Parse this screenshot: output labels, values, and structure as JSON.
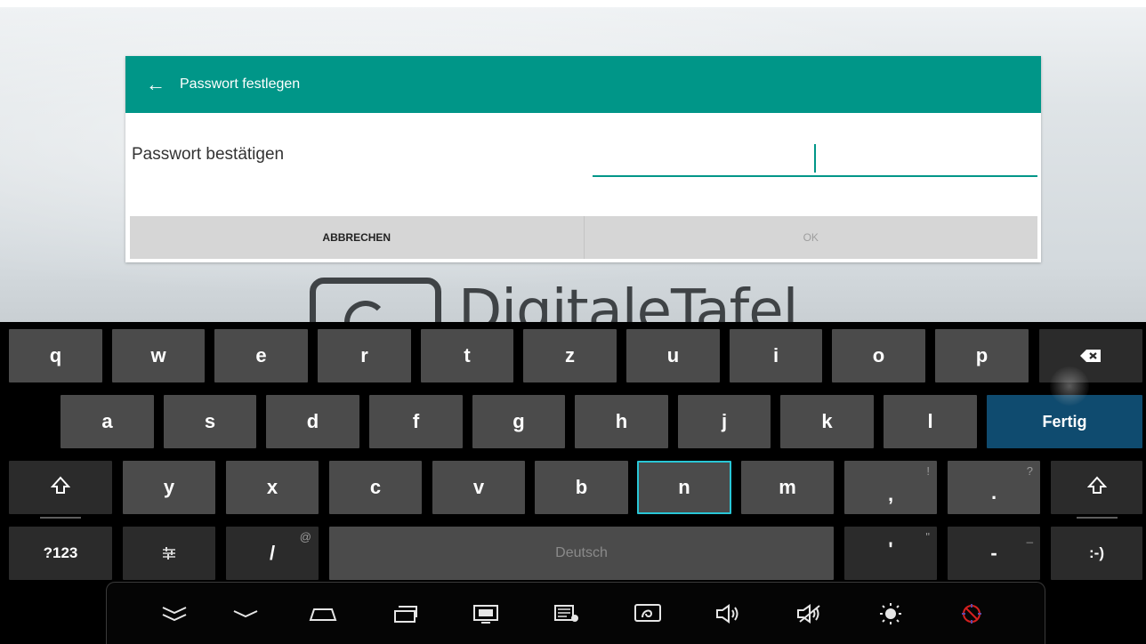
{
  "dialog": {
    "title": "Passwort festlegen",
    "field_label": "Passwort bestätigen",
    "password_value": "",
    "cancel_label": "ABBRECHEN",
    "ok_label": "OK",
    "accent_color": "#009688"
  },
  "background": {
    "logo_text": "DigitaleTafel"
  },
  "keyboard": {
    "row1": [
      "q",
      "w",
      "e",
      "r",
      "t",
      "z",
      "u",
      "i",
      "o",
      "p"
    ],
    "row2": [
      "a",
      "s",
      "d",
      "f",
      "g",
      "h",
      "j",
      "k",
      "l"
    ],
    "row3": [
      "y",
      "x",
      "c",
      "v",
      "b",
      "n",
      "m",
      ",",
      "."
    ],
    "row3_hints": {
      "comma": "!",
      "period": "?"
    },
    "done_label": "Fertig",
    "symbols_label": "?123",
    "slash_label": "/",
    "slash_hint": "@",
    "space_label": "Deutsch",
    "quote_label": "'",
    "quote_hint": "\"",
    "dash_label": "-",
    "dash_hint": "_",
    "smiley_label": ":-)",
    "selected_key": "n",
    "done_color": "#0f4b6f"
  },
  "navbar": {
    "icons": [
      "collapse-keyboard-icon",
      "back-icon",
      "home-icon",
      "recent-apps-icon",
      "screen-display-icon",
      "screen-settings-icon",
      "touch-icon",
      "volume-up-icon",
      "mute-icon",
      "brightness-icon",
      "disabled-icon"
    ]
  }
}
